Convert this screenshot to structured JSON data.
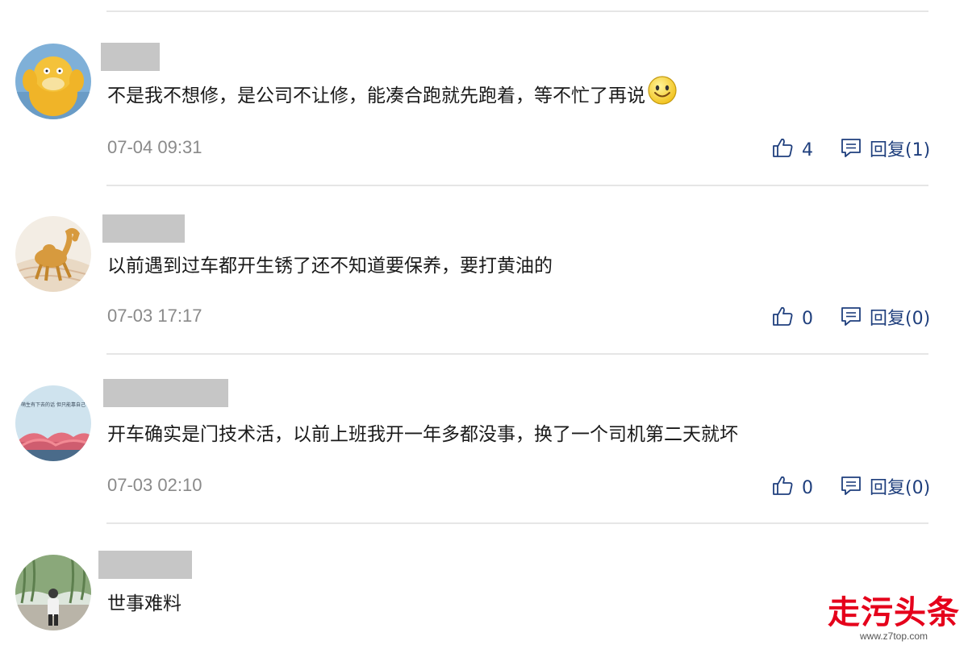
{
  "comments": [
    {
      "text": "不是我不想修，是公司不让修，能凑合跑就先跑着，等不忙了再说",
      "emoji": "smile-emoji",
      "time": "07-04 09:31",
      "likes": "4",
      "reply": "回复(1)"
    },
    {
      "text": "以前遇到过车都开生锈了还不知道要保养，要打黄油的",
      "time": "07-03 17:17",
      "likes": "0",
      "reply": "回复(0)"
    },
    {
      "text": "开车确实是门技术活，以前上班我开一年多都没事，换了一个司机第二天就坏",
      "avatar_text": "萌生有下去的话 但只能靠自己",
      "time": "07-03 02:10",
      "likes": "0",
      "reply": "回复(0)"
    },
    {
      "text": "世事难料"
    }
  ],
  "icons": {
    "like": "thumbs-up-icon",
    "reply": "comment-icon"
  },
  "colors": {
    "action": "#1f3f7d",
    "timestamp": "#8a8a8a",
    "watermark": "#e5001b"
  },
  "watermark": {
    "title": "走污头条",
    "url": "www.z7top.com"
  }
}
